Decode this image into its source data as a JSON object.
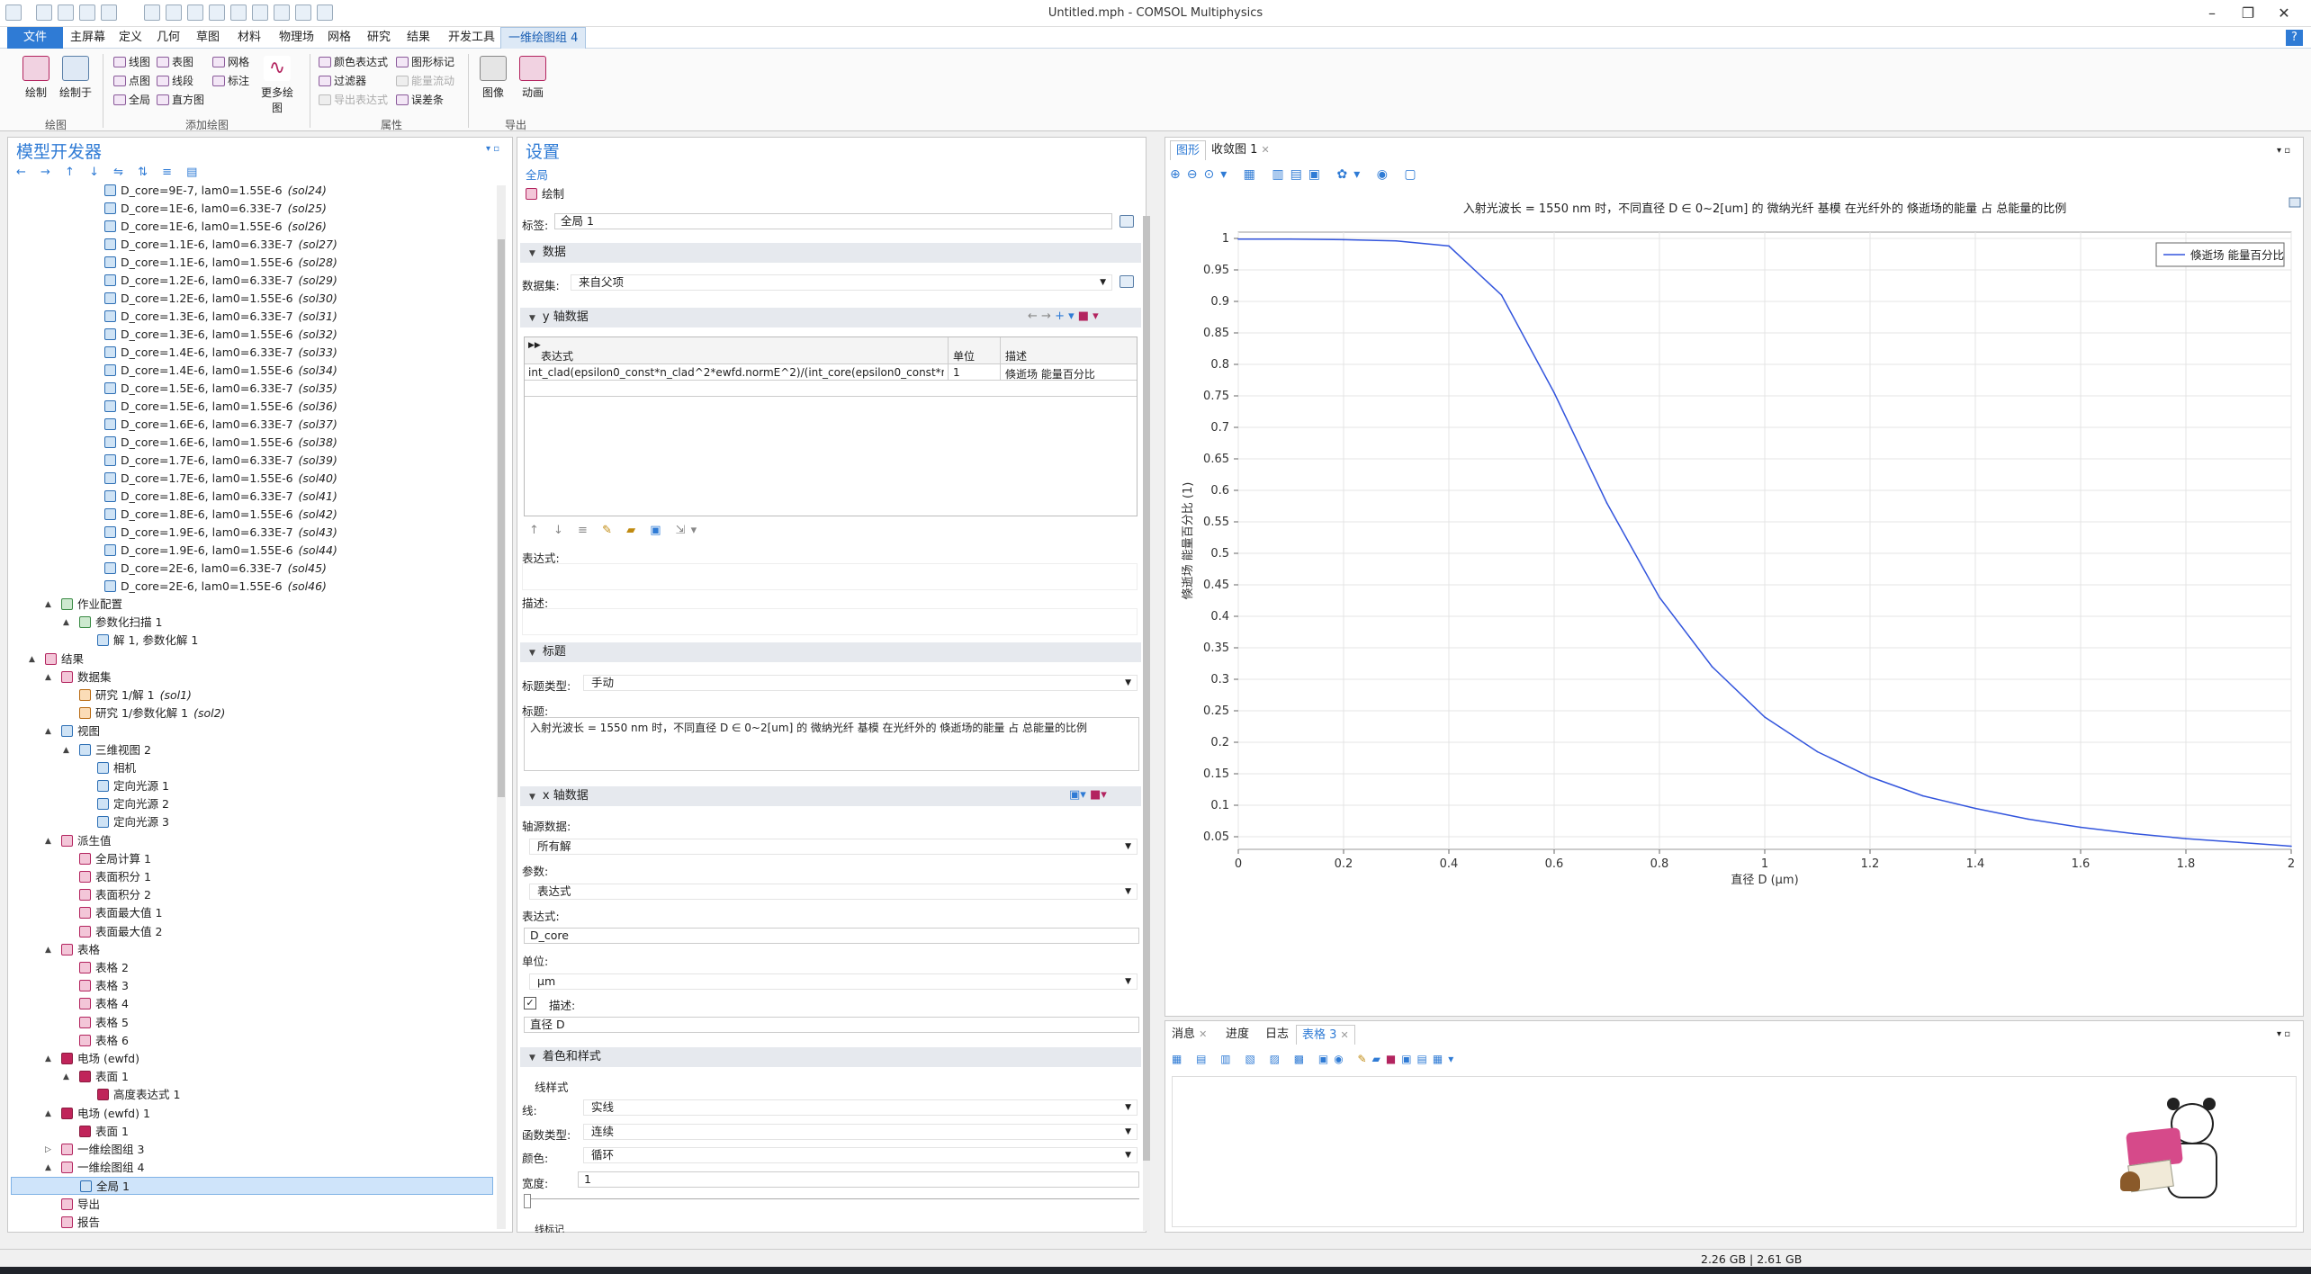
{
  "window": {
    "title": "Untitled.mph - COMSOL Multiphysics",
    "minimize": "–",
    "restore": "❐",
    "close": "✕",
    "help": "?"
  },
  "menu": [
    "文件",
    "主屏幕",
    "定义",
    "几何",
    "草图",
    "材料",
    "物理场",
    "网格",
    "研究",
    "结果",
    "开发工具",
    "一维绘图组 4"
  ],
  "ribbon": {
    "plot": "绘制",
    "plot_in": "绘制于",
    "line_graph": "线图",
    "surface": "表图",
    "mesh": "网格",
    "point_graph": "点图",
    "line_segments": "线段",
    "annotation": "标注",
    "global": "全局",
    "histogram": "直方图",
    "more_plots": "更多绘图",
    "color_expr": "颜色表达式",
    "graph_marker": "图形标记",
    "filter": "过滤器",
    "energy_flow": "能量流动",
    "export_expr": "导出表达式",
    "error_bar": "误差条",
    "image": "图像",
    "animation": "动画",
    "groups": {
      "plot": "绘图",
      "add_plot": "添加绘图",
      "attributes": "属性",
      "export": "导出"
    }
  },
  "model_builder": {
    "title": "模型开发器",
    "solutions": [
      {
        "label": "D_core=9E-7, lam0=1.55E-6",
        "tag": "(sol24)"
      },
      {
        "label": "D_core=1E-6, lam0=6.33E-7",
        "tag": "(sol25)"
      },
      {
        "label": "D_core=1E-6, lam0=1.55E-6",
        "tag": "(sol26)"
      },
      {
        "label": "D_core=1.1E-6, lam0=6.33E-7",
        "tag": "(sol27)"
      },
      {
        "label": "D_core=1.1E-6, lam0=1.55E-6",
        "tag": "(sol28)"
      },
      {
        "label": "D_core=1.2E-6, lam0=6.33E-7",
        "tag": "(sol29)"
      },
      {
        "label": "D_core=1.2E-6, lam0=1.55E-6",
        "tag": "(sol30)"
      },
      {
        "label": "D_core=1.3E-6, lam0=6.33E-7",
        "tag": "(sol31)"
      },
      {
        "label": "D_core=1.3E-6, lam0=1.55E-6",
        "tag": "(sol32)"
      },
      {
        "label": "D_core=1.4E-6, lam0=6.33E-7",
        "tag": "(sol33)"
      },
      {
        "label": "D_core=1.4E-6, lam0=1.55E-6",
        "tag": "(sol34)"
      },
      {
        "label": "D_core=1.5E-6, lam0=6.33E-7",
        "tag": "(sol35)"
      },
      {
        "label": "D_core=1.5E-6, lam0=1.55E-6",
        "tag": "(sol36)"
      },
      {
        "label": "D_core=1.6E-6, lam0=6.33E-7",
        "tag": "(sol37)"
      },
      {
        "label": "D_core=1.6E-6, lam0=1.55E-6",
        "tag": "(sol38)"
      },
      {
        "label": "D_core=1.7E-6, lam0=6.33E-7",
        "tag": "(sol39)"
      },
      {
        "label": "D_core=1.7E-6, lam0=1.55E-6",
        "tag": "(sol40)"
      },
      {
        "label": "D_core=1.8E-6, lam0=6.33E-7",
        "tag": "(sol41)"
      },
      {
        "label": "D_core=1.8E-6, lam0=1.55E-6",
        "tag": "(sol42)"
      },
      {
        "label": "D_core=1.9E-6, lam0=6.33E-7",
        "tag": "(sol43)"
      },
      {
        "label": "D_core=1.9E-6, lam0=1.55E-6",
        "tag": "(sol44)"
      },
      {
        "label": "D_core=2E-6, lam0=6.33E-7",
        "tag": "(sol45)"
      },
      {
        "label": "D_core=2E-6, lam0=1.55E-6",
        "tag": "(sol46)"
      }
    ],
    "tree": [
      {
        "label": "作业配置",
        "lvl": 3,
        "icon": "grn",
        "exp": "▲"
      },
      {
        "label": "参数化扫描 1",
        "lvl": 4,
        "icon": "grn",
        "exp": "▲"
      },
      {
        "label": "解 1, 参数化解 1",
        "lvl": 5,
        "icon": "",
        "exp": ""
      },
      {
        "label": "结果",
        "lvl": 2,
        "icon": "pink",
        "exp": "▲"
      },
      {
        "label": "数据集",
        "lvl": 3,
        "icon": "pink",
        "exp": "▲"
      },
      {
        "label": "研究 1/解 1",
        "tag": "(sol1)",
        "lvl": 4,
        "icon": "org",
        "exp": ""
      },
      {
        "label": "研究 1/参数化解 1",
        "tag": "(sol2)",
        "lvl": 4,
        "icon": "org",
        "exp": ""
      },
      {
        "label": "视图",
        "lvl": 3,
        "icon": "",
        "exp": "▲"
      },
      {
        "label": "三维视图 2",
        "lvl": 4,
        "icon": "",
        "exp": "▲"
      },
      {
        "label": "相机",
        "lvl": 5,
        "icon": "",
        "exp": ""
      },
      {
        "label": "定向光源 1",
        "lvl": 5,
        "icon": "",
        "exp": ""
      },
      {
        "label": "定向光源 2",
        "lvl": 5,
        "icon": "",
        "exp": ""
      },
      {
        "label": "定向光源 3",
        "lvl": 5,
        "icon": "",
        "exp": ""
      },
      {
        "label": "派生值",
        "lvl": 3,
        "icon": "pink",
        "exp": "▲"
      },
      {
        "label": "全局计算 1",
        "lvl": 4,
        "icon": "pink",
        "exp": ""
      },
      {
        "label": "表面积分 1",
        "lvl": 4,
        "icon": "pink",
        "exp": ""
      },
      {
        "label": "表面积分 2",
        "lvl": 4,
        "icon": "pink",
        "exp": ""
      },
      {
        "label": "表面最大值 1",
        "lvl": 4,
        "icon": "pink",
        "exp": ""
      },
      {
        "label": "表面最大值 2",
        "lvl": 4,
        "icon": "pink",
        "exp": ""
      },
      {
        "label": "表格",
        "lvl": 3,
        "icon": "pink",
        "exp": "▲"
      },
      {
        "label": "表格 2",
        "lvl": 4,
        "icon": "pink",
        "exp": ""
      },
      {
        "label": "表格 3",
        "lvl": 4,
        "icon": "pink",
        "exp": ""
      },
      {
        "label": "表格 4",
        "lvl": 4,
        "icon": "pink",
        "exp": ""
      },
      {
        "label": "表格 5",
        "lvl": 4,
        "icon": "pink",
        "exp": ""
      },
      {
        "label": "表格 6",
        "lvl": 4,
        "icon": "pink",
        "exp": ""
      },
      {
        "label": "电场 (ewfd)",
        "lvl": 3,
        "icon": "dk",
        "exp": "▲"
      },
      {
        "label": "表面 1",
        "lvl": 4,
        "icon": "dk",
        "exp": "▲"
      },
      {
        "label": "高度表达式 1",
        "lvl": 5,
        "icon": "dk",
        "exp": ""
      },
      {
        "label": "电场 (ewfd) 1",
        "lvl": 3,
        "icon": "dk",
        "exp": "▲"
      },
      {
        "label": "表面 1",
        "lvl": 4,
        "icon": "dk",
        "exp": ""
      },
      {
        "label": "一维绘图组 3",
        "lvl": 3,
        "icon": "pink",
        "exp": "▷"
      },
      {
        "label": "一维绘图组 4",
        "lvl": 3,
        "icon": "pink",
        "exp": "▲"
      },
      {
        "label": "全局 1",
        "lvl": 4,
        "icon": "",
        "exp": "",
        "selected": true
      },
      {
        "label": "导出",
        "lvl": 3,
        "icon": "pink",
        "exp": ""
      },
      {
        "label": "报告",
        "lvl": 3,
        "icon": "pink",
        "exp": ""
      }
    ]
  },
  "settings": {
    "title": "设置",
    "subtitle": "全局",
    "plot_btn": "绘制",
    "label_lbl": "标签:",
    "label_val": "全局 1",
    "data_sec": "数据",
    "dataset_lbl": "数据集:",
    "dataset_val": "来自父项",
    "y_sec": "y 轴数据",
    "table_headers": [
      "表达式",
      "单位",
      "描述"
    ],
    "table_row": [
      "int_clad(epsilon0_const*n_clad^2*ewfd.normE^2)/(int_core(epsilon0_const*n_c...",
      "1",
      "倏逝场 能量百分比"
    ],
    "expr_lbl": "表达式:",
    "desc_lbl": "描述:",
    "title_sec": "标题",
    "title_type_lbl": "标题类型:",
    "title_type_val": "手动",
    "title_lbl": "标题:",
    "title_val": "入射光波长 = 1550 nm 时，不同直径 D ∈ 0~2[um] 的 微纳光纤 基模 在光纤外的 倏逝场的能量 占 总能量的比例",
    "x_sec": "x 轴数据",
    "axis_src_lbl": "轴源数据:",
    "axis_src_val": "所有解",
    "param_lbl": "参数:",
    "param_val": "表达式",
    "xexpr_lbl": "表达式:",
    "xexpr_val": "D_core",
    "unit_lbl": "单位:",
    "unit_val": "μm",
    "xdesc_lbl": "描述:",
    "xdesc_val": "直径 D",
    "color_sec": "着色和样式",
    "line_style_lbl": "线样式",
    "line_lbl": "线:",
    "line_val": "实线",
    "func_lbl": "函数类型:",
    "func_val": "连续",
    "color_lbl": "颜色:",
    "color_val": "循环",
    "width_lbl": "宽度:",
    "width_val": "1",
    "marker_lbl": "线标记"
  },
  "graphics": {
    "tabs": [
      "图形",
      "收敛图 1"
    ],
    "bottom_tabs": [
      "消息",
      "进度",
      "日志",
      "表格 3"
    ]
  },
  "chart_data": {
    "type": "line",
    "title": "入射光波长 = 1550 nm 时，不同直径 D ∈ 0~2[um] 的 微纳光纤 基模 在光纤外的 倏逝场的能量 占 总能量的比例",
    "xlabel": "直径 D (μm)",
    "ylabel": "倏逝场 能量百分比 (1)",
    "xlim": [
      0,
      2
    ],
    "ylim": [
      0.03,
      1.01
    ],
    "xticks": [
      0,
      0.2,
      0.4,
      0.6,
      0.8,
      1,
      1.2,
      1.4,
      1.6,
      1.8,
      2
    ],
    "yticks": [
      0.05,
      0.1,
      0.15,
      0.2,
      0.25,
      0.3,
      0.35,
      0.4,
      0.45,
      0.5,
      0.55,
      0.6,
      0.65,
      0.7,
      0.75,
      0.8,
      0.85,
      0.9,
      0.95,
      1
    ],
    "grid": true,
    "legend_position": "top-right",
    "line_color": "#3355dd",
    "series": [
      {
        "name": "倏逝场 能量百分比",
        "x": [
          0,
          0.1,
          0.2,
          0.3,
          0.4,
          0.5,
          0.6,
          0.7,
          0.8,
          0.9,
          1.0,
          1.1,
          1.2,
          1.3,
          1.4,
          1.5,
          1.6,
          1.7,
          1.8,
          1.9,
          2.0
        ],
        "y": [
          0.999,
          0.999,
          0.998,
          0.996,
          0.988,
          0.91,
          0.755,
          0.58,
          0.43,
          0.32,
          0.24,
          0.185,
          0.145,
          0.115,
          0.095,
          0.078,
          0.065,
          0.055,
          0.047,
          0.041,
          0.035
        ]
      }
    ]
  },
  "status": {
    "memory": "2.26 GB | 2.61 GB"
  }
}
